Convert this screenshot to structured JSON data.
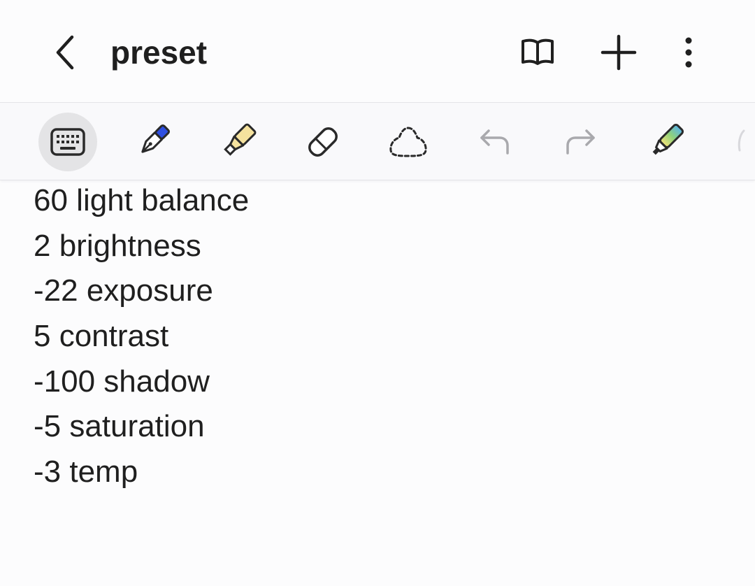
{
  "header": {
    "title": "preset",
    "icons": {
      "back": "chevron-left-icon",
      "reading_mode": "book-open-icon",
      "add": "plus-icon",
      "more": "more-vertical-icon"
    }
  },
  "toolbar": {
    "tools": [
      {
        "name": "keyboard",
        "icon": "keyboard-icon",
        "active": true
      },
      {
        "name": "pen",
        "icon": "fountain-pen-icon",
        "color": "#2f4fe0"
      },
      {
        "name": "highlighter",
        "icon": "highlighter-icon",
        "color": "#f5e29e"
      },
      {
        "name": "eraser",
        "icon": "eraser-icon"
      },
      {
        "name": "lasso",
        "icon": "lasso-select-icon"
      },
      {
        "name": "undo",
        "icon": "undo-icon"
      },
      {
        "name": "redo",
        "icon": "redo-icon"
      },
      {
        "name": "rainbow-pen",
        "icon": "rainbow-pen-icon"
      }
    ]
  },
  "note": {
    "lines": [
      "60 light balance",
      "2 brightness",
      "-22 exposure",
      "5 contrast",
      "-100 shadow",
      "-5 saturation",
      "-3 temp"
    ]
  },
  "colors": {
    "background": "#fcfcfd",
    "text": "#1f1f1f",
    "toolbar_bg": "#f9f9fb",
    "active_tool_bg": "#e4e4e6",
    "disabled_icon": "#a9a9ad"
  }
}
